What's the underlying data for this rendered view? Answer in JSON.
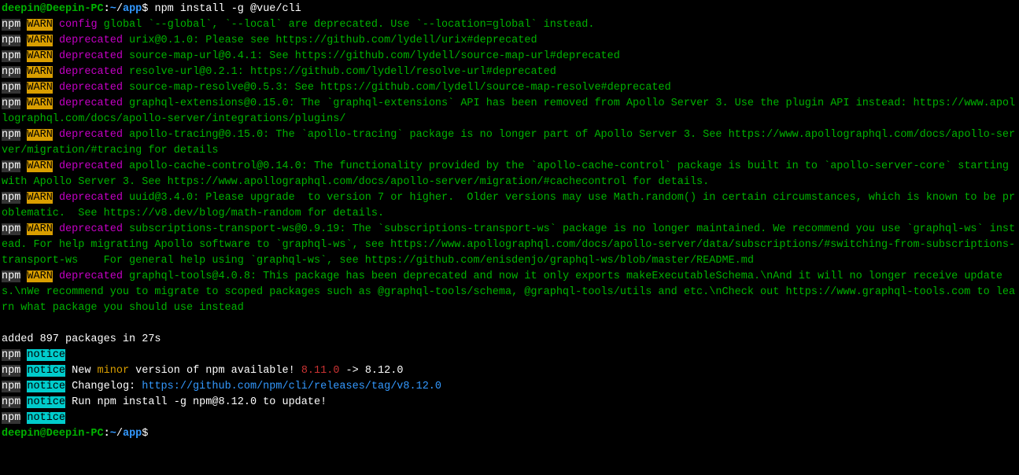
{
  "prompt": {
    "user": "deepin",
    "at": "@",
    "host": "Deepin-PC",
    "colon": ":",
    "tilde": "~",
    "slash": "/",
    "app": "app",
    "dollar": "$ ",
    "cmd": "npm install -g @vue/cli"
  },
  "npm": "npm",
  "warn": "WARN",
  "notice": "notice",
  "config": "config",
  "deprecated": "deprecated",
  "lines": {
    "config_global": " global `--global`, `--local` are deprecated. Use `--location=global` instead.",
    "urix": " urix@0.1.0: Please see https://github.com/lydell/urix#deprecated",
    "source_map_url": " source-map-url@0.4.1: See https://github.com/lydell/source-map-url#deprecated",
    "resolve_url": " resolve-url@0.2.1: https://github.com/lydell/resolve-url#deprecated",
    "source_map_resolve": " source-map-resolve@0.5.3: See https://github.com/lydell/source-map-resolve#deprecated",
    "graphql_extensions": " graphql-extensions@0.15.0: The `graphql-extensions` API has been removed from Apollo Server 3. Use the plugin API instead: https://www.apollographql.com/docs/apollo-server/integrations/plugins/",
    "apollo_tracing": " apollo-tracing@0.15.0: The `apollo-tracing` package is no longer part of Apollo Server 3. See https://www.apollographql.com/docs/apollo-server/migration/#tracing for details",
    "apollo_cache_control": " apollo-cache-control@0.14.0: The functionality provided by the `apollo-cache-control` package is built in to `apollo-server-core` starting with Apollo Server 3. See https://www.apollographql.com/docs/apollo-server/migration/#cachecontrol for details.",
    "uuid": " uuid@3.4.0: Please upgrade  to version 7 or higher.  Older versions may use Math.random() in certain circumstances, which is known to be problematic.  See https://v8.dev/blog/math-random for details.",
    "subscriptions": " subscriptions-transport-ws@0.9.19: The `subscriptions-transport-ws` package is no longer maintained. We recommend you use `graphql-ws` instead. For help migrating Apollo software to `graphql-ws`, see https://www.apollographql.com/docs/apollo-server/data/subscriptions/#switching-from-subscriptions-transport-ws    For general help using `graphql-ws`, see https://github.com/enisdenjo/graphql-ws/blob/master/README.md",
    "graphql_tools": " graphql-tools@4.0.8: This package has been deprecated and now it only exports makeExecutableSchema.\\nAnd it will no longer receive updates.\\nWe recommend you to migrate to scoped packages such as @graphql-tools/schema, @graphql-tools/utils and etc.\\nCheck out https://www.graphql-tools.com to learn what package you should use instead"
  },
  "added": "added 897 packages in 27s",
  "notice_new_pre": " New ",
  "notice_minor": "minor",
  "notice_new_post": " version of npm available! ",
  "notice_old_version": "8.11.0",
  "notice_arrow": " -> 8.12.0",
  "notice_changelog_pre": " Changelog: ",
  "notice_changelog_link": "https://github.com/npm/cli/releases/tag/v8.12.0",
  "notice_run": " Run npm install -g npm@8.12.0 to update!"
}
